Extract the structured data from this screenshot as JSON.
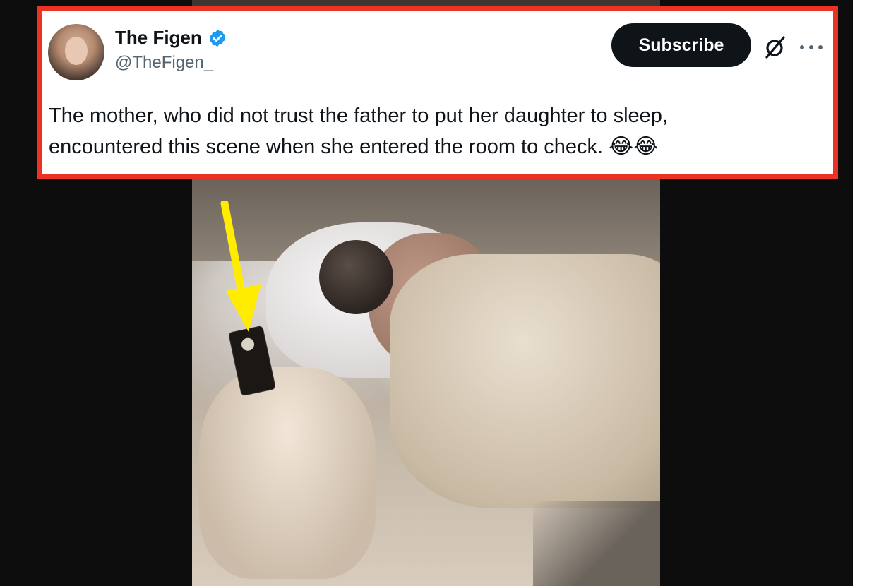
{
  "tweet": {
    "display_name": "The Figen",
    "handle": "@TheFigen_",
    "subscribe_label": "Subscribe",
    "text_line1": "The mother, who did not trust the father to put her daughter to sleep,",
    "text_line2": "encountered this scene when she entered the room to check.",
    "emoji": "😂😂",
    "verified_color": "#1d9bf0",
    "highlight_border_color": "#ea3323"
  },
  "annotation": {
    "arrow_color": "#ffec00",
    "icon": "down-arrow-icon"
  },
  "icons": [
    "verified-badge-icon",
    "grok-icon",
    "more-icon"
  ]
}
